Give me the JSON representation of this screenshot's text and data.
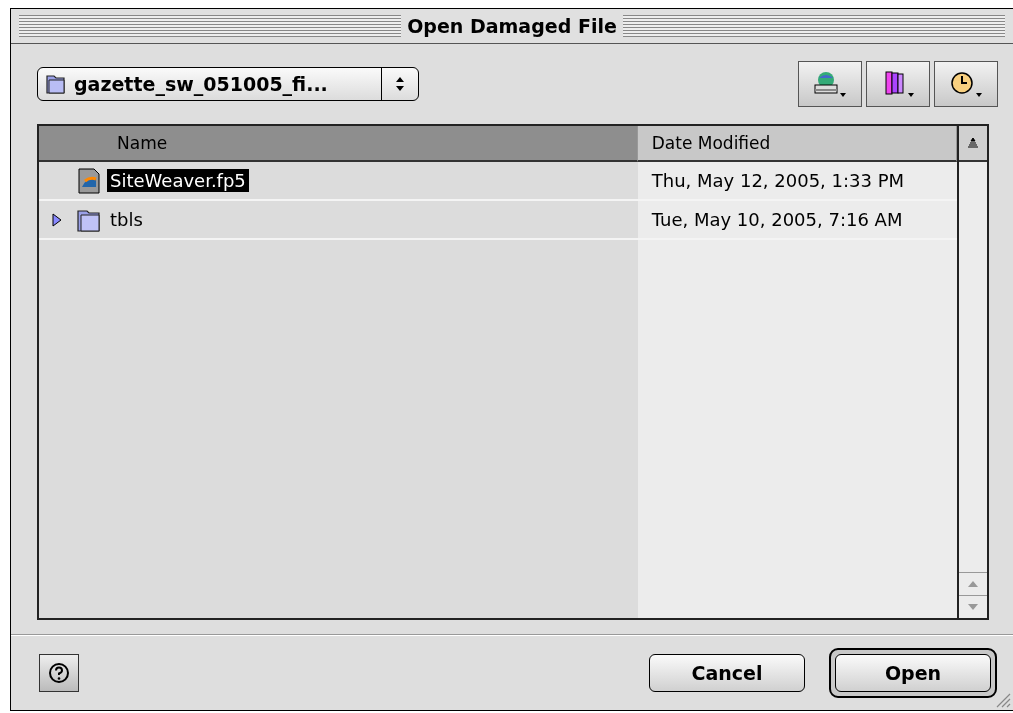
{
  "window": {
    "title": "Open Damaged File"
  },
  "location": {
    "label": "gazette_sw_051005_fi..."
  },
  "toolbar": [
    {
      "kind": "drive"
    },
    {
      "kind": "favorites"
    },
    {
      "kind": "recent"
    }
  ],
  "table": {
    "columns": [
      {
        "label": "Name",
        "sorted": true
      },
      {
        "label": "Date Modified",
        "sorted": false
      }
    ],
    "rows": [
      {
        "kind": "file",
        "name": "SiteWeaver.fp5",
        "date": "Thu, May 12, 2005, 1:33 PM",
        "selected": true
      },
      {
        "kind": "folder",
        "name": "tbls",
        "date": "Tue, May 10, 2005, 7:16 AM",
        "selected": false,
        "expanded": false
      }
    ]
  },
  "buttons": [
    {
      "label": "Cancel",
      "default": false
    },
    {
      "label": "Open",
      "default": true
    }
  ]
}
